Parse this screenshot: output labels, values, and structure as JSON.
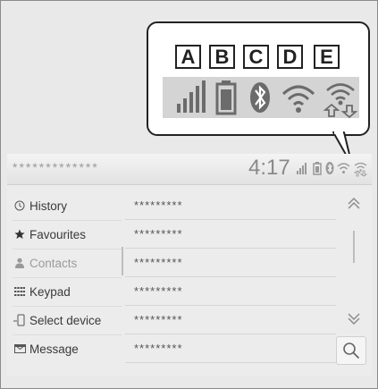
{
  "callout": {
    "labels": [
      "A",
      "B",
      "C",
      "D",
      "E"
    ],
    "icons": [
      "signal-strength-icon",
      "battery-icon",
      "bluetooth-icon",
      "wifi-icon",
      "wifi-data-transfer-icon"
    ]
  },
  "status_bar": {
    "device_name": "*************",
    "time": "4:17"
  },
  "menu": {
    "items": [
      {
        "label": "History",
        "icon": "history-icon"
      },
      {
        "label": "Favourites",
        "icon": "star-icon"
      },
      {
        "label": "Contacts",
        "icon": "person-icon",
        "active": true
      },
      {
        "label": "Keypad",
        "icon": "keypad-icon"
      },
      {
        "label": "Select device",
        "icon": "phone-device-icon"
      },
      {
        "label": "Message",
        "icon": "envelope-icon"
      }
    ]
  },
  "entries": [
    "*********",
    "*********",
    "*********",
    "*********",
    "*********",
    "*********"
  ],
  "colors": {
    "screen_bg": "#ececec",
    "text_dark": "#3a3a3a",
    "text_muted": "#9b9b9b"
  }
}
